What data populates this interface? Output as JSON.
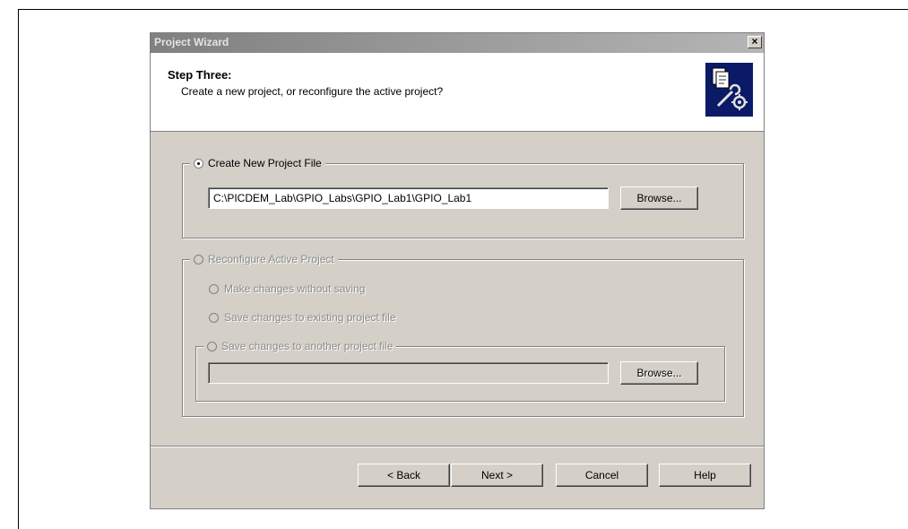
{
  "window": {
    "title": "Project Wizard",
    "close_symbol": "×"
  },
  "header": {
    "step_title": "Step Three:",
    "step_subtitle": "Create a new project, or reconfigure the active project?",
    "icon": "project-wizard-icon"
  },
  "create_group": {
    "label": "Create New Project File",
    "selected": true,
    "path_value": "C:\\PICDEM_Lab\\GPIO_Labs\\GPIO_Lab1\\GPIO_Lab1",
    "browse_label": "Browse..."
  },
  "reconfigure_group": {
    "label": "Reconfigure Active Project",
    "enabled": false,
    "options": [
      {
        "label": "Make changes without saving"
      },
      {
        "label": "Save changes to existing project file"
      }
    ],
    "another_group": {
      "label": "Save changes to another project file",
      "path_value": "",
      "browse_label": "Browse..."
    }
  },
  "footer": {
    "back_label": "< Back",
    "next_label": "Next >",
    "cancel_label": "Cancel",
    "help_label": "Help"
  },
  "colors": {
    "dialog_bg": "#d4d0c8",
    "title_gradient_start": "#808080",
    "icon_bg": "#0a1a66"
  }
}
